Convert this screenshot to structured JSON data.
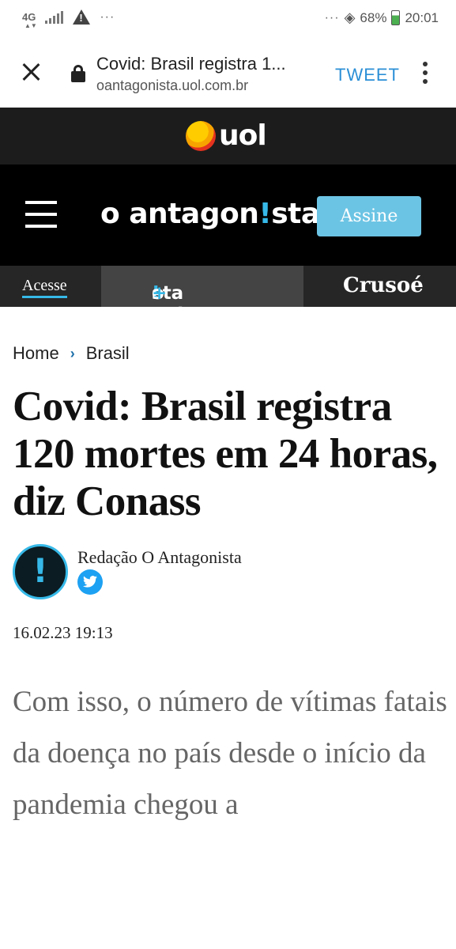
{
  "status_bar": {
    "network": "4G",
    "more": "···",
    "more_right": "···",
    "battery": "68%",
    "time": "20:01"
  },
  "custom_tab": {
    "title": "Covid: Brasil registra 1...",
    "host": "oantagonista.uol.com.br",
    "tweet_label": "TWEET"
  },
  "uol": {
    "logo_text": "uol"
  },
  "header": {
    "brand_pre": "o antagon",
    "brand_accent": "!",
    "brand_post": "sta",
    "subscribe_label": "Assine"
  },
  "subnav": {
    "acesse": "Acesse",
    "plus_pre": "o antagon",
    "plus_accent": "!",
    "plus_post": "sta",
    "plus_sign": "+",
    "crusoe": "Crusoé"
  },
  "breadcrumb": {
    "home": "Home",
    "sep": "›",
    "section": "Brasil"
  },
  "article": {
    "headline": "Covid: Brasil registra 120 mortes em 24 horas, diz Conass",
    "avatar_glyph": "!",
    "author": "Redação O Antagonista",
    "date": "16.02.23 19:13",
    "lead": "Com isso, o número de vítimas fatais da doença no país desde o início da pandemia chegou a"
  },
  "colors": {
    "accent": "#36b9e8",
    "link": "#2b8fd6",
    "header_bg": "#000000"
  }
}
